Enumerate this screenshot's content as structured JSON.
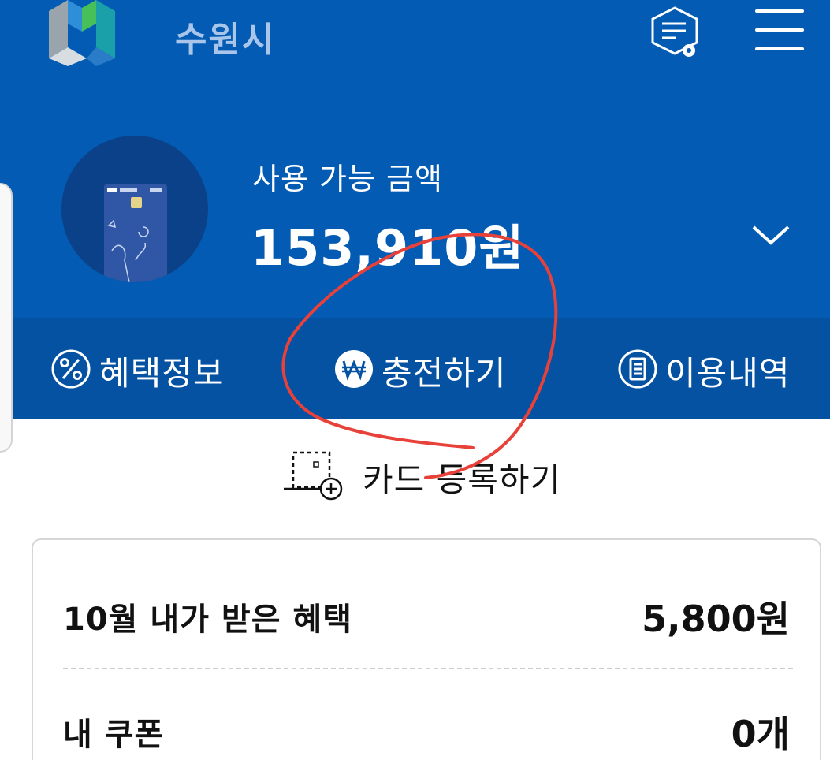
{
  "header": {
    "title": "수원시",
    "logo_icon": "suwon-logo-icon",
    "settings_icon": "notification-settings-icon",
    "menu_icon": "hamburger-menu-icon"
  },
  "summary": {
    "card_image_icon": "local-currency-card-icon",
    "balance_label": "사용 가능 금액",
    "balance_amount": "153,910원",
    "expand_icon": "chevron-down-icon"
  },
  "actions": [
    {
      "label": "혜택정보",
      "icon": "percent-icon"
    },
    {
      "label": "충전하기",
      "icon": "won-icon"
    },
    {
      "label": "이용내역",
      "icon": "list-document-icon"
    }
  ],
  "register": {
    "label": "카드 등록하기",
    "icon": "card-add-icon"
  },
  "info": {
    "rows": [
      {
        "label": "10월 내가 받은 혜택",
        "value": "5,800원"
      },
      {
        "label": "내 쿠폰",
        "value": "0개"
      }
    ]
  },
  "colors": {
    "header_blue": "#035bb3",
    "action_bar_blue": "#0552a3",
    "annotation_red": "#e8413a"
  }
}
